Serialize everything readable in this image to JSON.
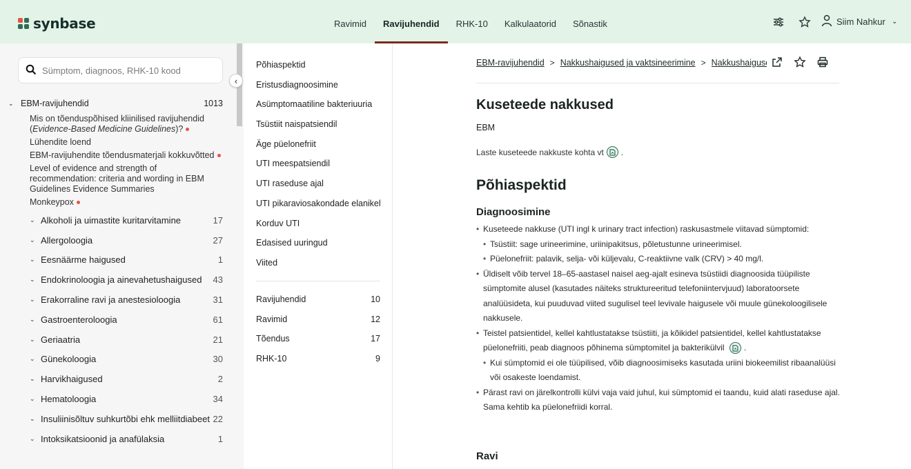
{
  "header": {
    "logo_text": "synbase",
    "nav": [
      "Ravimid",
      "Ravijuhendid",
      "RHK-10",
      "Kalkulaatorid",
      "Sõnastik"
    ],
    "active_nav": "Ravijuhendid",
    "user_name": "Siim Nahkur"
  },
  "sidebar": {
    "search_placeholder": "Sümptom, diagnoos, RHK-10 kood",
    "root": {
      "label": "EBM-ravijuhendid",
      "count": "1013"
    },
    "links": [
      {
        "text_prefix": "Mis on tõenduspõhised kliinilised ravijuhendid (",
        "text_em": "Evidence-Based Medicine Guidelines",
        "text_suffix": ")?"
      },
      {
        "text": "Lühendite loend"
      },
      {
        "text": "EBM-ravijuhendite tõendusmaterjali kokkuvõtted"
      },
      {
        "text": "Level of evidence and strength of recommendation: criteria and wording in EBM Guidelines Evidence Summaries"
      },
      {
        "text": "Monkeypox"
      }
    ],
    "categories": [
      {
        "label": "Alkoholi ja uimastite kuritarvitamine",
        "count": "17"
      },
      {
        "label": "Allergoloogia",
        "count": "27"
      },
      {
        "label": "Eesnäärme haigused",
        "count": "1"
      },
      {
        "label": "Endokrinoloogia ja ainevahetushaigused",
        "count": "43"
      },
      {
        "label": "Erakorraline ravi ja anestesioloogia",
        "count": "31"
      },
      {
        "label": "Gastroenteroloogia",
        "count": "61"
      },
      {
        "label": "Geriaatria",
        "count": "21"
      },
      {
        "label": "Günekoloogia",
        "count": "30"
      },
      {
        "label": "Harvikhaigused",
        "count": "2"
      },
      {
        "label": "Hematoloogia",
        "count": "34"
      },
      {
        "label": "Insuliinisõltuv suhkurtõbi ehk melliitdiabeet",
        "count": "22"
      },
      {
        "label": "Intoksikatsioonid ja anafülaksia",
        "count": "1"
      }
    ]
  },
  "toc": {
    "items": [
      "Põhiaspektid",
      "Eristusdiagnoosimine",
      "Asümptomaatiline bakteriuuria",
      "Tsüstiit naispatsiendil",
      "Äge püelonefriit",
      "UTI meespatsiendil",
      "UTI raseduse ajal",
      "UTI pikaraviosakondade elanikel",
      "Korduv UTI",
      "Edasised uuringud",
      "Viited"
    ],
    "counts": [
      {
        "label": "Ravijuhendid",
        "count": "10"
      },
      {
        "label": "Ravimid",
        "count": "12"
      },
      {
        "label": "Tõendus",
        "count": "17"
      },
      {
        "label": "RHK-10",
        "count": "9"
      }
    ]
  },
  "breadcrumb": [
    "EBM-ravijuhendid",
    "Nakkushaigused ja vaktsineerimine",
    "Nakkushaigused"
  ],
  "article": {
    "title": "Kuseteede nakkused",
    "source": "EBM",
    "note": "Laste kuseteede nakkuste kohta vt",
    "section": "Põhiaspektid",
    "subsection": "Diagnoosimine",
    "b1": "Kuseteede nakkuse (UTI ingl k urinary tract infection) raskusastmele viitavad sümptomid:",
    "b1a": "Tsüstiit: sage urineerimine, uriinipakitsus, põletustunne urineerimisel.",
    "b1b": "Püelonefriit: palavik, selja- või küljevalu, C-reaktiivne valk (CRV) > 40 mg/l.",
    "b2": "Üldiselt võib tervel 18–65-aastasel naisel aeg-ajalt esineva tsüstiidi diagnoosida tüüpiliste sümptomite alusel (kasutades näiteks struktureeritud telefoniintervjuud) laboratoorsete analüüsideta, kui puuduvad viited sugulisel teel levivale haigusele või muule günekoloogilisele nakkusele.",
    "b3": "Teistel patsientidel, kellel kahtlustatakse tsüstiiti, ja kõikidel patsientidel, kellel kahtlustatakse püelonefriiti, peab diagnoos põhinema sümptomitel ja bakterikülvil",
    "b3a": "Kui sümptomid ei ole tüüpilised, võib diagnoosimiseks kasutada uriini biokeemilist ribaanalüüsi või osakeste loendamist.",
    "b4": "Pärast ravi on järelkontrolli külvi vaja vaid juhul, kui sümptomid ei taandu, kuid alati raseduse ajal. Sama kehtib ka püelonefriidi korral.",
    "next_heading": "Ravi"
  }
}
